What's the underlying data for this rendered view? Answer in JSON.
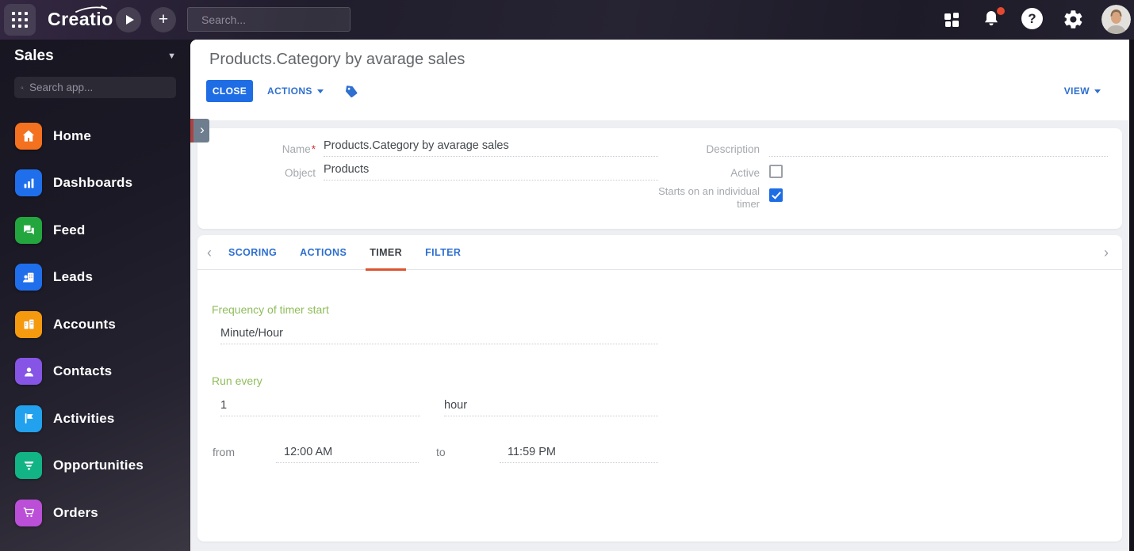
{
  "topbar": {
    "logo": "Creatio",
    "search_placeholder": "Search..."
  },
  "sidebar": {
    "workspace": "Sales",
    "search_placeholder": "Search app...",
    "items": [
      {
        "label": "Home",
        "icon": "home-icon",
        "color": "#f4711f"
      },
      {
        "label": "Dashboards",
        "icon": "dashboards-icon",
        "color": "#1f6fec"
      },
      {
        "label": "Feed",
        "icon": "feed-icon",
        "color": "#23a63e"
      },
      {
        "label": "Leads",
        "icon": "leads-icon",
        "color": "#1f6fec"
      },
      {
        "label": "Accounts",
        "icon": "accounts-icon",
        "color": "#f5990f"
      },
      {
        "label": "Contacts",
        "icon": "contacts-icon",
        "color": "#8655e6"
      },
      {
        "label": "Activities",
        "icon": "activities-icon",
        "color": "#22a2ee"
      },
      {
        "label": "Opportunities",
        "icon": "opportunities-icon",
        "color": "#12b385"
      },
      {
        "label": "Orders",
        "icon": "orders-icon",
        "color": "#bb4fd8"
      }
    ]
  },
  "page": {
    "title": "Products.Category by avarage sales",
    "close_label": "CLOSE",
    "actions_label": "ACTIONS",
    "view_label": "VIEW"
  },
  "form": {
    "name_label": "Name",
    "name_value": "Products.Category by avarage sales",
    "object_label": "Object",
    "object_value": "Products",
    "description_label": "Description",
    "description_value": "",
    "active_label": "Active",
    "active_checked": false,
    "individual_timer_label": "Starts on an individual timer",
    "individual_timer_checked": true
  },
  "tabs": [
    {
      "label": "SCORING",
      "active": false
    },
    {
      "label": "ACTIONS",
      "active": false
    },
    {
      "label": "TIMER",
      "active": true
    },
    {
      "label": "FILTER",
      "active": false
    }
  ],
  "timer": {
    "frequency_label": "Frequency of timer start",
    "frequency_value": "Minute/Hour",
    "run_every_label": "Run every",
    "run_every_value": "1",
    "run_every_unit": "hour",
    "from_label": "from",
    "from_value": "12:00 AM",
    "to_label": "to",
    "to_value": "11:59 PM"
  },
  "colors": {
    "accent_blue": "#1f6de4",
    "tab_underline": "#dc5330",
    "green_label": "#8fbd5b",
    "notification_dot": "#e5492f"
  }
}
